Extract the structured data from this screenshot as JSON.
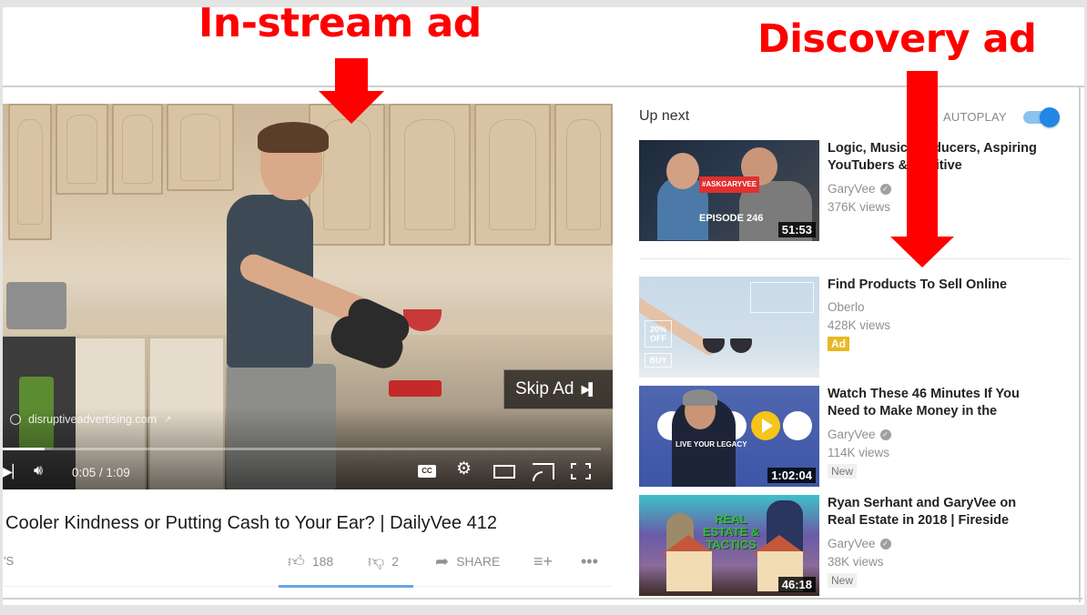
{
  "annotations": {
    "instream_label": "In-stream ad",
    "discovery_label": "Discovery ad",
    "color": "#ff0000"
  },
  "player": {
    "ad_url": "disruptiveadvertising.com",
    "skip_ad_label": "Skip Ad",
    "skip_icon": "▶▌",
    "time_current": "0:05",
    "time_total": "1:09",
    "time_display": "0:05 / 1:09",
    "progress_fraction": 0.07,
    "icons": [
      "next-icon",
      "volume-icon",
      "captions-icon",
      "settings-gear-icon",
      "theater-mode-icon",
      "cast-icon",
      "fullscreen-icon"
    ],
    "cc_label": "CC"
  },
  "video": {
    "title": "Cooler Kindness or Putting Cash to Your Ear? | DailyVee 412",
    "views_fragment": "'S",
    "likes": "188",
    "dislikes": "2",
    "share_label": "SHARE",
    "like_ratio": 0.99,
    "accent_color": "#64a7e8"
  },
  "sidebar": {
    "up_next_label": "Up next",
    "autoplay_label": "AUTOPLAY",
    "autoplay_on": true,
    "toggle_color": "#2186e6",
    "items": [
      {
        "title": "Logic, Music Producers, Aspiring YouTubers & Positive",
        "channel": "GaryVee",
        "verified": true,
        "views": "376K views",
        "duration": "51:53",
        "thumb_text": "#ASKGARYVEE",
        "thumb_sub": "EPISODE 246",
        "badge": null
      },
      {
        "title": "Find Products To Sell Online",
        "channel": "Oberlo",
        "verified": false,
        "views": "428K views",
        "badge": "Ad",
        "badge_color": "#e8b823",
        "thumb_promo": "20% OFF",
        "thumb_buy": "BUY"
      },
      {
        "title": "Watch These 46 Minutes If You Need to Make Money in the",
        "channel": "GaryVee",
        "verified": true,
        "views": "114K views",
        "duration": "1:02:04",
        "thumb_text": "LIVE YOUR LEGACY",
        "badge": "New"
      },
      {
        "title": "Ryan Serhant and GaryVee on Real Estate in 2018 | Fireside",
        "channel": "GaryVee",
        "verified": true,
        "views": "38K views",
        "duration": "46:18",
        "thumb_text": "REAL ESTATE & TACTICS",
        "badge": "New"
      }
    ]
  }
}
